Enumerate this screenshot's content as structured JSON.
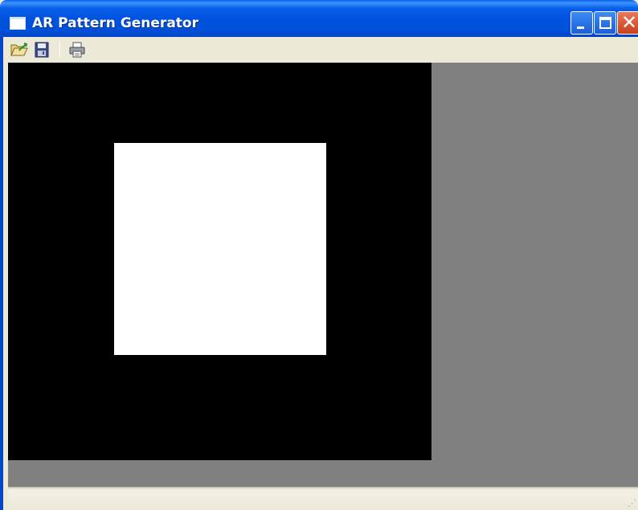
{
  "window": {
    "title": "AR Pattern Generator",
    "title_bar_color": "#0053e0",
    "controls": {
      "minimize_icon": "minimize-icon",
      "maximize_icon": "maximize-icon",
      "close_icon": "close-icon",
      "close_glyph": "✕"
    }
  },
  "toolbar": {
    "buttons": [
      {
        "name": "open",
        "icon": "folder-open-icon"
      },
      {
        "name": "save",
        "icon": "floppy-disk-icon"
      },
      {
        "name": "print",
        "icon": "printer-icon"
      }
    ]
  },
  "canvas": {
    "background_color": "#000000",
    "pattern_color": "#ffffff",
    "workspace_color": "#808080"
  },
  "statusbar": {
    "text": "",
    "grip_glyph": "⋰"
  }
}
